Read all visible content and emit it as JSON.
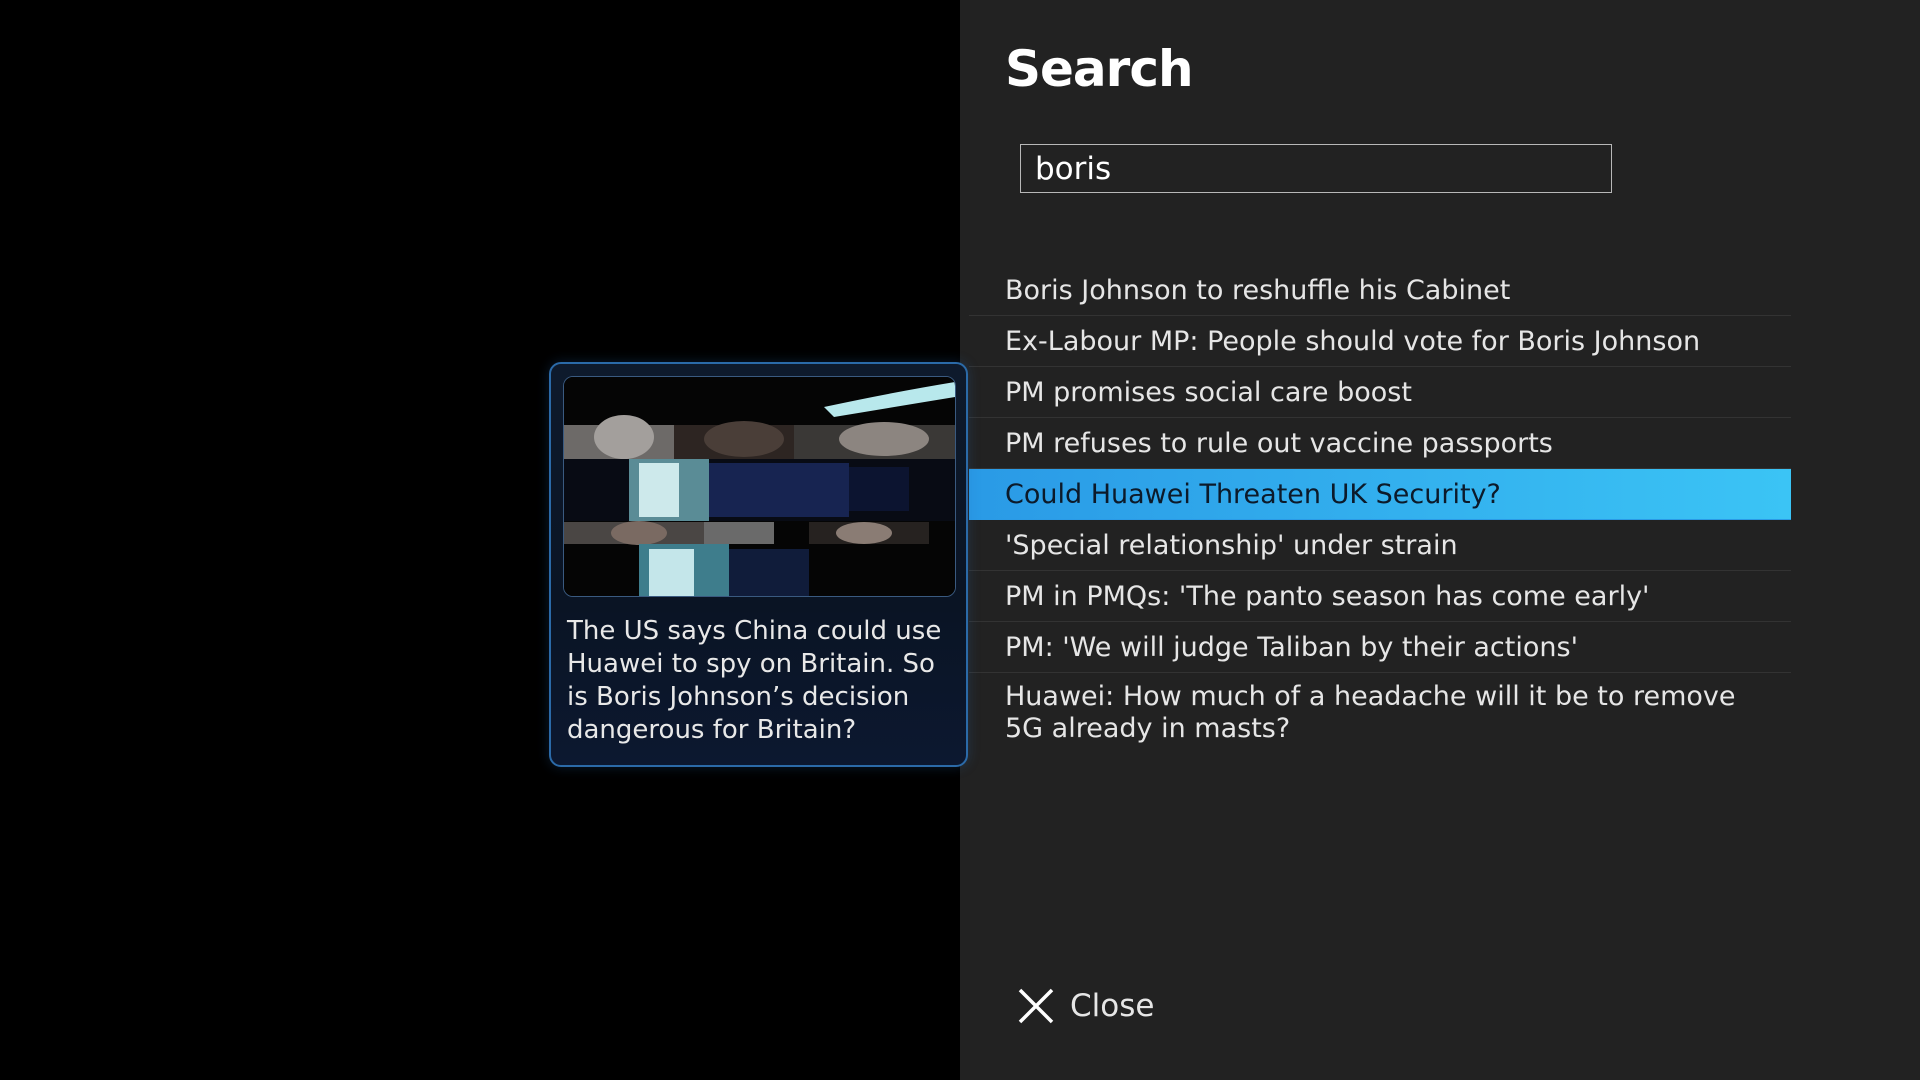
{
  "search": {
    "title": "Search",
    "query": "boris"
  },
  "results": [
    {
      "label": "Boris Johnson to reshuffle his Cabinet"
    },
    {
      "label": "Ex-Labour MP: People should vote for Boris Johnson"
    },
    {
      "label": "PM promises social care boost"
    },
    {
      "label": "PM refuses to rule out vaccine passports"
    },
    {
      "label": "Could Huawei Threaten UK Security?"
    },
    {
      "label": "'Special relationship' under strain"
    },
    {
      "label": "PM in PMQs: 'The panto season has come early'"
    },
    {
      "label": "PM: 'We will judge Taliban by their actions'"
    },
    {
      "label": "Huawei: How much of a headache will it be to remove 5G already in masts?"
    }
  ],
  "selected_index": 4,
  "preview": {
    "description": "The US says China could use Huawei to spy on Britain. So is Boris Johnson’s decision dangerous for Britain?"
  },
  "close": {
    "label": "Close",
    "icon": "close-icon"
  },
  "colors": {
    "panel_bg": "#222222",
    "highlight": "#3bc4f5",
    "card_border": "#2b6aa8"
  }
}
